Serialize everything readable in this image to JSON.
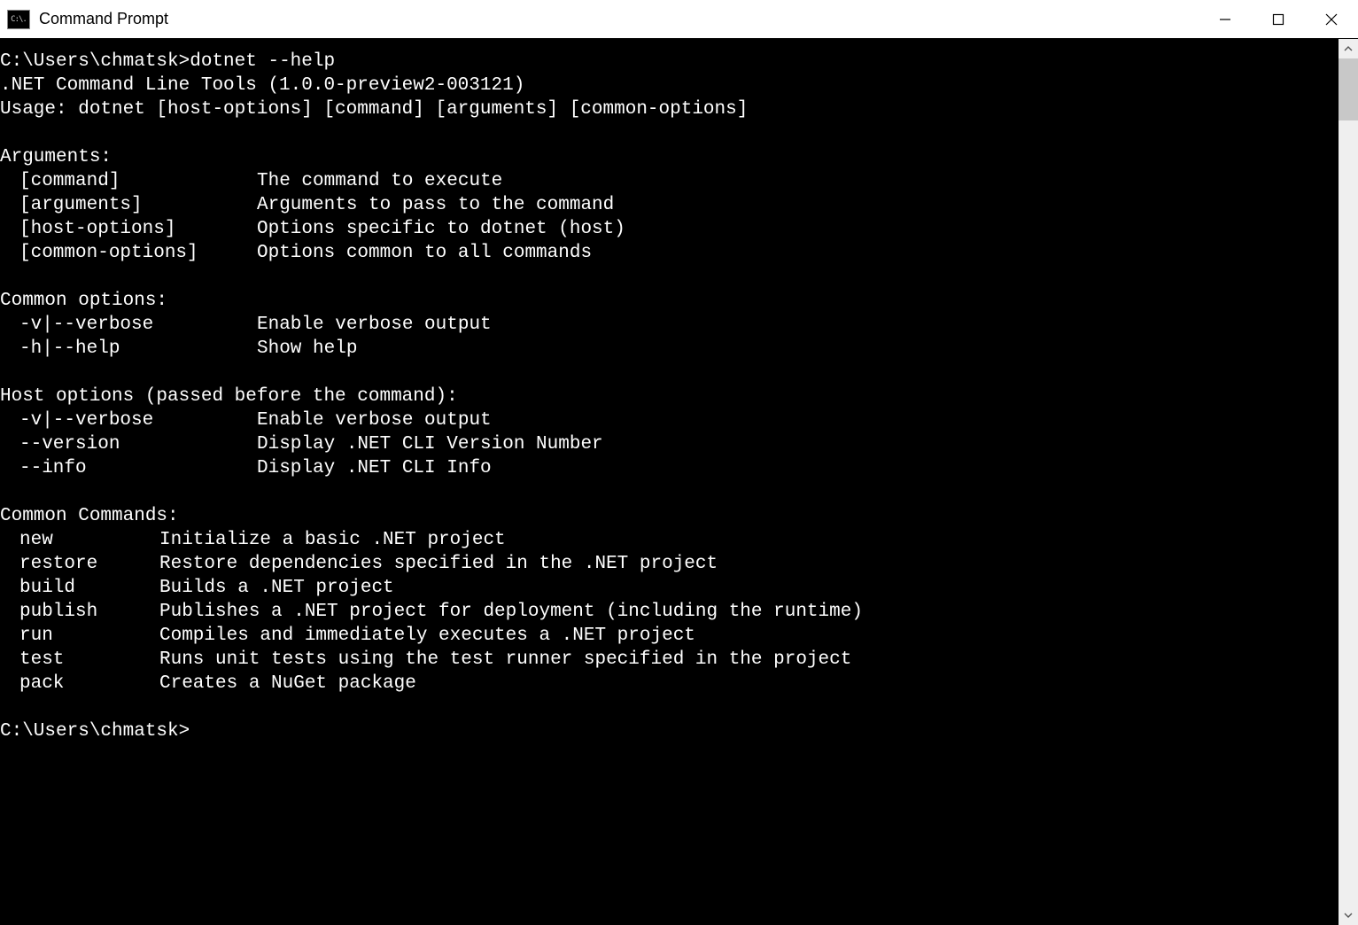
{
  "window": {
    "title": "Command Prompt",
    "icon_label": "C:\\."
  },
  "terminal": {
    "prompt1_prefix": "C:\\Users\\chmatsk>",
    "prompt1_cmd": "dotnet --help",
    "header_line": ".NET Command Line Tools (1.0.0-preview2-003121)",
    "usage_line": "Usage: dotnet [host-options] [command] [arguments] [common-options]",
    "arguments_heading": "Arguments:",
    "arguments": [
      {
        "name": "[command]",
        "desc": "The command to execute"
      },
      {
        "name": "[arguments]",
        "desc": "Arguments to pass to the command"
      },
      {
        "name": "[host-options]",
        "desc": "Options specific to dotnet (host)"
      },
      {
        "name": "[common-options]",
        "desc": "Options common to all commands"
      }
    ],
    "common_options_heading": "Common options:",
    "common_options": [
      {
        "name": "-v|--verbose",
        "desc": "Enable verbose output"
      },
      {
        "name": "-h|--help",
        "desc": "Show help"
      }
    ],
    "host_options_heading": "Host options (passed before the command):",
    "host_options": [
      {
        "name": "-v|--verbose",
        "desc": "Enable verbose output"
      },
      {
        "name": "--version",
        "desc": "Display .NET CLI Version Number"
      },
      {
        "name": "--info",
        "desc": "Display .NET CLI Info"
      }
    ],
    "commands_heading": "Common Commands:",
    "commands": [
      {
        "name": "new",
        "desc": "Initialize a basic .NET project"
      },
      {
        "name": "restore",
        "desc": "Restore dependencies specified in the .NET project"
      },
      {
        "name": "build",
        "desc": "Builds a .NET project"
      },
      {
        "name": "publish",
        "desc": "Publishes a .NET project for deployment (including the runtime)"
      },
      {
        "name": "run",
        "desc": "Compiles and immediately executes a .NET project"
      },
      {
        "name": "test",
        "desc": "Runs unit tests using the test runner specified in the project"
      },
      {
        "name": "pack",
        "desc": "Creates a NuGet package"
      }
    ],
    "prompt2": "C:\\Users\\chmatsk>"
  }
}
